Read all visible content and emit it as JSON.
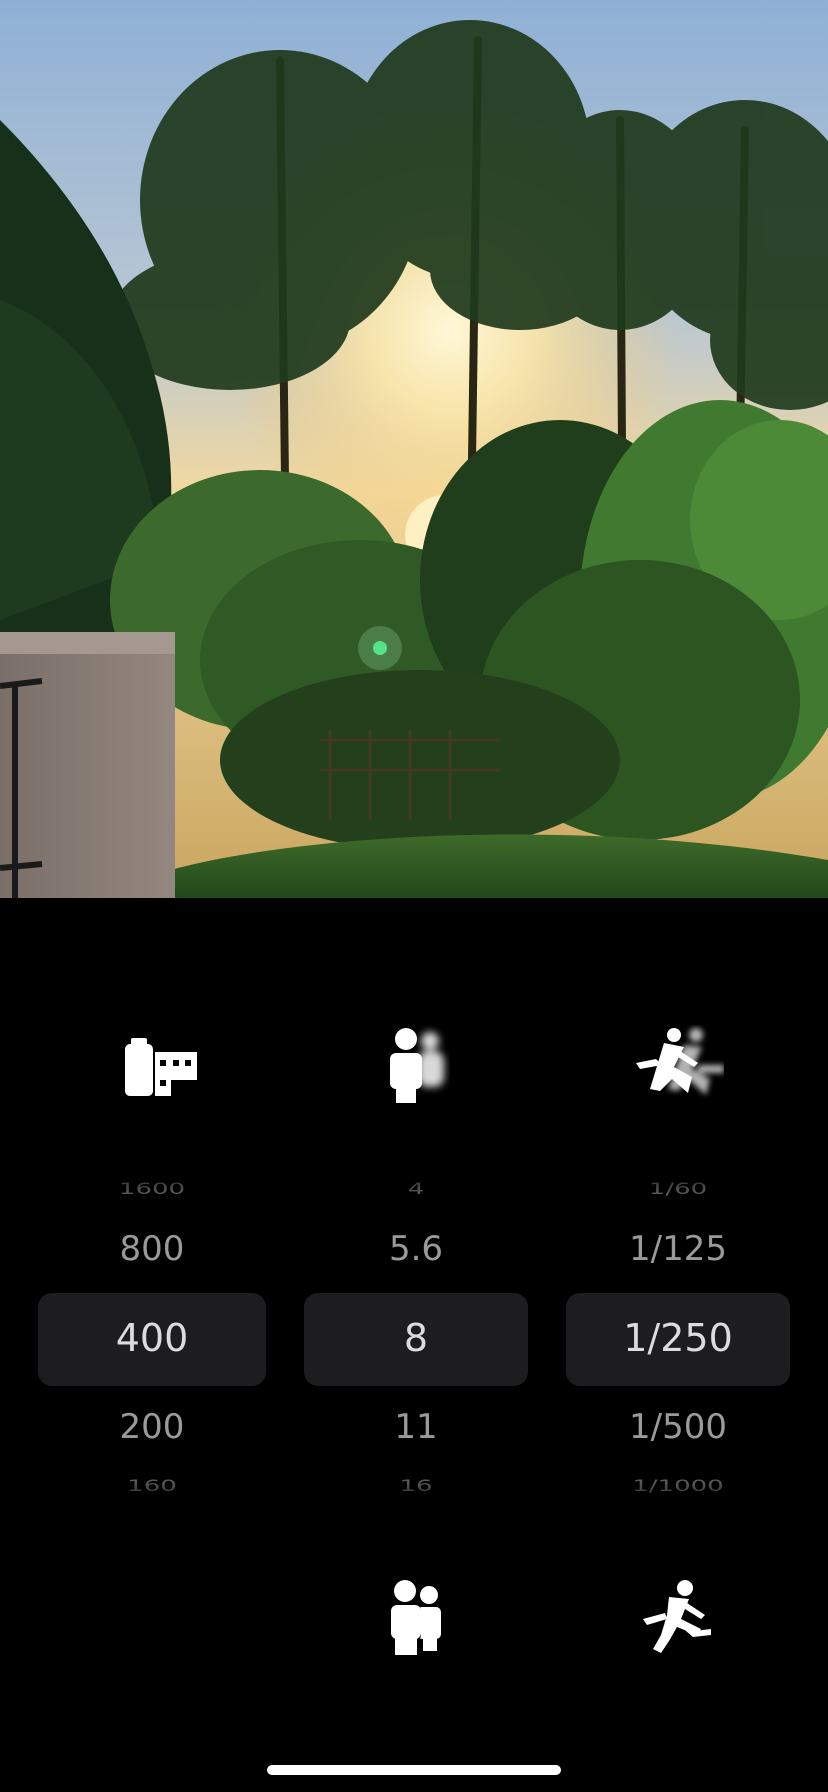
{
  "viewfinder": {
    "description_icon": "camera-preview"
  },
  "mode_icons": {
    "iso": "film-canister-icon",
    "aperture": "portrait-blur-icon",
    "shutter": "motion-blur-runner-icon",
    "aperture_alt": "group-people-icon",
    "shutter_alt": "running-person-icon"
  },
  "iso_wheel": {
    "far_top": "1600",
    "top": "800",
    "selected": "400",
    "bottom": "200",
    "far_bottom": "160"
  },
  "fstop_wheel": {
    "far_top": "4",
    "top": "5.6",
    "selected": "8",
    "bottom": "11",
    "far_bottom": "16"
  },
  "shutter_wheel": {
    "far_top": "1/60",
    "top": "1/125",
    "selected": "1/250",
    "bottom": "1/500",
    "far_bottom": "1/1000"
  },
  "colors": {
    "background": "#000000",
    "highlight": "#1d1d1f",
    "selected_text": "#dcdcdc"
  }
}
